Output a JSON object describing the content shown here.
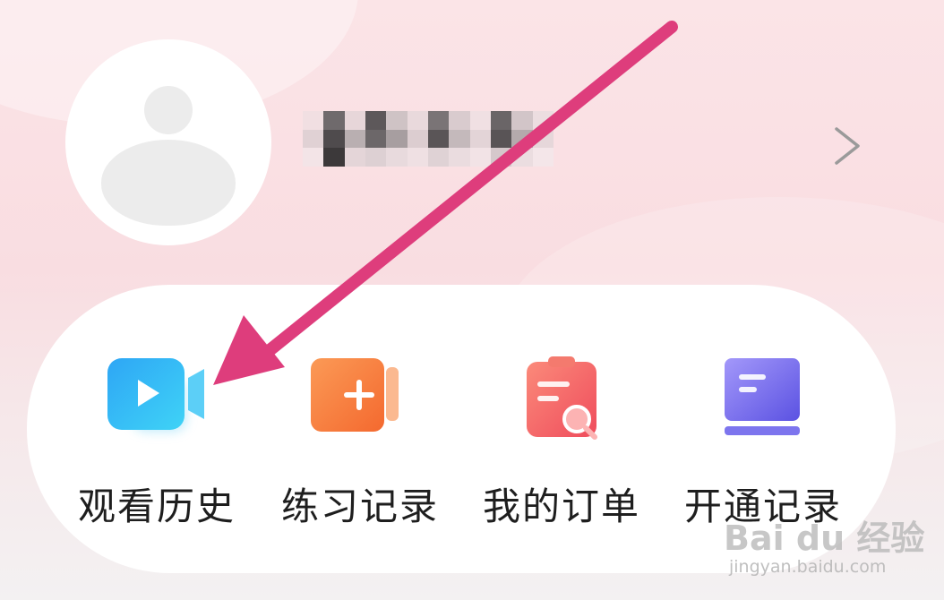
{
  "profile": {
    "avatar": "default-user-avatar",
    "username_blurred": true,
    "chevron_icon": "chevron-right-icon"
  },
  "shortcuts": [
    {
      "label": "观看历史",
      "icon": "video-camera-icon",
      "color": "#2bb5f4"
    },
    {
      "label": "练习记录",
      "icon": "plus-document-icon",
      "color": "#f7703c"
    },
    {
      "label": "我的订单",
      "icon": "clipboard-search-icon",
      "color": "#f25c61"
    },
    {
      "label": "开通记录",
      "icon": "book-stack-icon",
      "color": "#6e66e8"
    }
  ],
  "annotation": {
    "arrow_color": "#de3d7c",
    "arrow_icon": "pointer-arrow-icon"
  },
  "watermark": {
    "logo": "Bai du 经验",
    "url": "jingyan.baidu.com"
  }
}
